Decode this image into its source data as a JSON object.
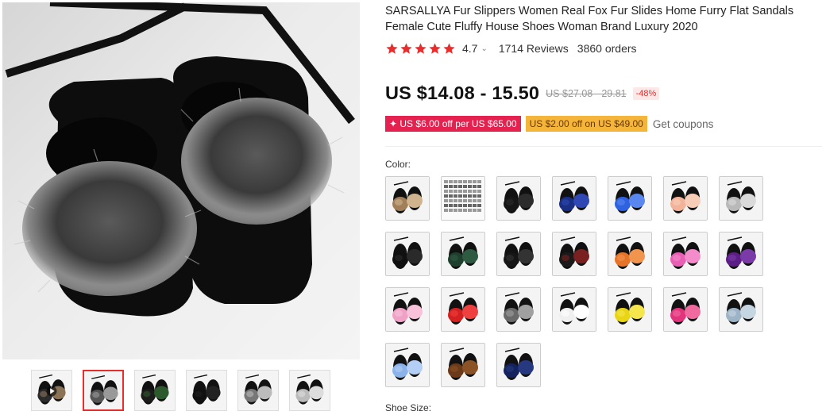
{
  "product": {
    "title": "SARSALLYA Fur Slippers Women Real Fox Fur Slides Home Furry Flat Sandals Female Cute Fluffy House Shoes Woman Brand Luxury 2020",
    "rating": "4.7",
    "rating_caret": "⌄",
    "reviews": "1714 Reviews",
    "orders": "3860 orders",
    "price": "US $14.08 - 15.50",
    "old_price": "US $27.08 - 29.81",
    "discount": "-48%",
    "star_count": 5,
    "star_color": "#e62e2e"
  },
  "coupons": {
    "select_coupon": "✦ US $6.00 off per US $65.00",
    "store_coupon": "US $2.00 off on US $49.00",
    "get_coupons_link": "Get coupons"
  },
  "options": {
    "color_label": "Color:",
    "size_label": "Shoe Size:"
  },
  "gallery": {
    "main_image": "image-black-silver-fox-fur-slides",
    "thumbnails": [
      {
        "name": "thumb-video",
        "colors": [
          "#2b2b2b",
          "#8b7356"
        ],
        "has_play": true
      },
      {
        "name": "thumb-silver-fox",
        "colors": [
          "#555",
          "#999"
        ],
        "active": true
      },
      {
        "name": "thumb-black-green-stripe",
        "colors": [
          "#1c1c1c",
          "#2d5a2d"
        ]
      },
      {
        "name": "thumb-black-pairs",
        "colors": [
          "#111",
          "#222"
        ]
      },
      {
        "name": "thumb-color-chart",
        "colors": [
          "#777",
          "#bbb"
        ]
      },
      {
        "name": "thumb-size-chart",
        "colors": [
          "#bbb",
          "#ddd"
        ]
      }
    ]
  },
  "color_swatches": [
    {
      "name": "natural-brown",
      "fur": "#a07f5a",
      "fur2": "#d0b48e"
    },
    {
      "name": "color-chart",
      "fur": "#777",
      "fur2": "#aaa",
      "chart": true
    },
    {
      "name": "black",
      "fur": "#161616",
      "fur2": "#2c2c2c"
    },
    {
      "name": "navy-blue",
      "fur": "#1a2e84",
      "fur2": "#2f48b3"
    },
    {
      "name": "royal-blue",
      "fur": "#2e62e0",
      "fur2": "#5a86ef"
    },
    {
      "name": "peach",
      "fur": "#f3b39a",
      "fur2": "#f8cdb8"
    },
    {
      "name": "light-grey",
      "fur": "#b9b9b9",
      "fur2": "#dadada"
    },
    {
      "name": "black-2",
      "fur": "#101010",
      "fur2": "#2a2a2a"
    },
    {
      "name": "dark-green",
      "fur": "#1e3f2e",
      "fur2": "#2e5a42"
    },
    {
      "name": "black-3",
      "fur": "#161616",
      "fur2": "#333"
    },
    {
      "name": "black-red-stripe",
      "fur": "#1a1a1a",
      "fur2": "#7a2020"
    },
    {
      "name": "orange",
      "fur": "#e5742a",
      "fur2": "#f1954e"
    },
    {
      "name": "hot-pink",
      "fur": "#e85fb4",
      "fur2": "#f48ccc"
    },
    {
      "name": "purple",
      "fur": "#5c1f86",
      "fur2": "#7a3aa8"
    },
    {
      "name": "pink",
      "fur": "#f0a2c6",
      "fur2": "#f7c2da"
    },
    {
      "name": "red",
      "fur": "#d42020",
      "fur2": "#ef4040"
    },
    {
      "name": "silver-grey",
      "fur": "#6a6a6a",
      "fur2": "#a0a0a0"
    },
    {
      "name": "white",
      "fur": "#f0f0f0",
      "fur2": "#ffffff"
    },
    {
      "name": "yellow",
      "fur": "#e8d515",
      "fur2": "#f5e64e"
    },
    {
      "name": "rose",
      "fur": "#e3337c",
      "fur2": "#ef6a9f"
    },
    {
      "name": "grey-blue",
      "fur": "#9db3c6",
      "fur2": "#c6d5e2"
    },
    {
      "name": "sky-blue",
      "fur": "#8bb3ea",
      "fur2": "#b4cff5"
    },
    {
      "name": "coffee",
      "fur": "#6a3a1a",
      "fur2": "#8b5225"
    },
    {
      "name": "dark-navy",
      "fur": "#14235e",
      "fur2": "#26387f"
    }
  ]
}
